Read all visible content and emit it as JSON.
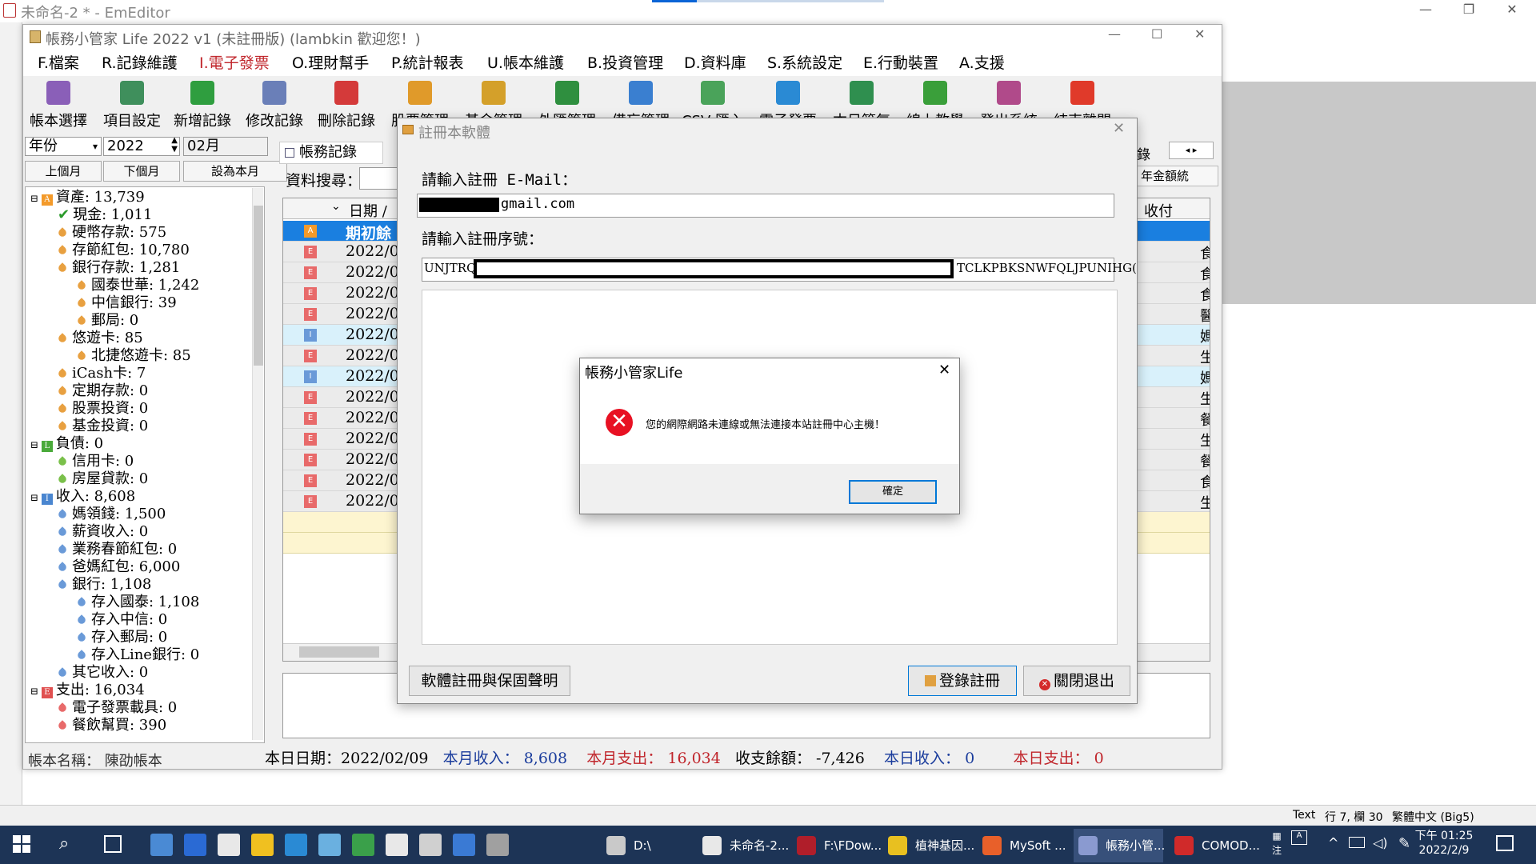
{
  "editor": {
    "title": "未命名-2 * - EmEditor",
    "status": {
      "mode": "Text",
      "position": "行 7, 欄 30",
      "encoding": "繁體中文 (Big5)"
    }
  },
  "app": {
    "title": "帳務小管家 Life 2022 v1 (未註冊版) (lambkin 歡迎您！)",
    "menu": [
      "F.檔案",
      "R.記錄維護",
      "I.電子發票",
      "O.理財幫手",
      "P.統計報表",
      "U.帳本維護",
      "B.投資管理",
      "D.資料庫",
      "S.系統設定",
      "E.行動裝置",
      "A.支援"
    ],
    "toolbar": [
      {
        "label": "帳本選擇",
        "icon": "book-select-icon",
        "color": "#8a5fb8"
      },
      {
        "label": "項目設定",
        "icon": "item-settings-icon",
        "color": "#3f8f5c"
      },
      {
        "label": "新增記錄",
        "icon": "add-record-icon",
        "color": "#2f9e3f"
      },
      {
        "label": "修改記錄",
        "icon": "edit-record-icon",
        "color": "#6a7fb8"
      },
      {
        "label": "刪除記錄",
        "icon": "delete-record-icon",
        "color": "#d43a3a"
      },
      {
        "label": "股票管理",
        "icon": "stock-icon",
        "color": "#e09a2a"
      },
      {
        "label": "基金管理",
        "icon": "fund-icon",
        "color": "#d4a02a"
      },
      {
        "label": "外匯管理",
        "icon": "forex-icon",
        "color": "#2f8f3f"
      },
      {
        "label": "備忘管理",
        "icon": "memo-icon",
        "color": "#3a7fd0"
      },
      {
        "label": "CSV 匯入",
        "icon": "csv-import-icon",
        "color": "#4aa35a"
      },
      {
        "label": "電子發票",
        "icon": "einvoice-icon",
        "color": "#2a8ad4"
      },
      {
        "label": "本日節氣",
        "icon": "solar-term-icon",
        "color": "#2f8f4f"
      },
      {
        "label": "線上教學",
        "icon": "help-icon",
        "color": "#3a9f3a"
      },
      {
        "label": "登出系統",
        "icon": "logout-icon",
        "color": "#b04a8a"
      },
      {
        "label": "結束離開",
        "icon": "exit-icon",
        "color": "#e03a2a"
      }
    ],
    "filter": {
      "period": "年份",
      "year": "2022",
      "month": "02月",
      "prev": "上個月",
      "next": "下個月",
      "set_current": "設為本月"
    },
    "tab_label": "帳務記錄",
    "search_label": "資料搜尋：",
    "right_tab": "錄",
    "right_button": "年金額統",
    "grid_header": {
      "date": "日期 /",
      "paid": "收付"
    },
    "grid_rows": [
      {
        "date": "期初餘",
        "type": "A",
        "right": ""
      },
      {
        "date": "2022/0",
        "type": "E",
        "right": "食"
      },
      {
        "date": "2022/0",
        "type": "E",
        "right": "食"
      },
      {
        "date": "2022/0",
        "type": "E",
        "right": "食"
      },
      {
        "date": "2022/0",
        "type": "E",
        "right": "醫"
      },
      {
        "date": "2022/0",
        "type": "I",
        "right": "媽"
      },
      {
        "date": "2022/0",
        "type": "E",
        "right": "生"
      },
      {
        "date": "2022/0",
        "type": "I",
        "right": "媽"
      },
      {
        "date": "2022/0",
        "type": "E",
        "right": "生"
      },
      {
        "date": "2022/0",
        "type": "E",
        "right": "餐"
      },
      {
        "date": "2022/0",
        "type": "E",
        "right": "生"
      },
      {
        "date": "2022/0",
        "type": "E",
        "right": "餐"
      },
      {
        "date": "2022/0",
        "type": "E",
        "right": "食"
      },
      {
        "date": "2022/0",
        "type": "E",
        "right": "生"
      }
    ],
    "tree": [
      {
        "text": "資產: 13,739",
        "level": 1,
        "sq": "A",
        "color": "#f39a2a"
      },
      {
        "text": "現金: 1,011",
        "level": 2,
        "check": true
      },
      {
        "text": "硬幣存款: 575",
        "level": 2,
        "color": "#e8a040"
      },
      {
        "text": "存節紅包: 10,780",
        "level": 2,
        "color": "#e8a040"
      },
      {
        "text": "銀行存款: 1,281",
        "level": 2,
        "color": "#e8a040"
      },
      {
        "text": "國泰世華: 1,242",
        "level": 3,
        "color": "#e8a040"
      },
      {
        "text": "中信銀行: 39",
        "level": 3,
        "color": "#e8a040"
      },
      {
        "text": "郵局: 0",
        "level": 3,
        "color": "#e8a040"
      },
      {
        "text": "悠遊卡: 85",
        "level": 2,
        "color": "#e8a040"
      },
      {
        "text": "北捷悠遊卡: 85",
        "level": 3,
        "color": "#e8a040"
      },
      {
        "text": "iCash卡: 7",
        "level": 2,
        "color": "#e8a040"
      },
      {
        "text": "定期存款: 0",
        "level": 2,
        "color": "#e8a040"
      },
      {
        "text": "股票投資: 0",
        "level": 2,
        "color": "#e8a040"
      },
      {
        "text": "基金投資: 0",
        "level": 2,
        "color": "#e8a040"
      },
      {
        "text": "負債: 0",
        "level": 1,
        "sq": "L",
        "color": "#4aaa3a"
      },
      {
        "text": "信用卡: 0",
        "level": 2,
        "color": "#7ac04a"
      },
      {
        "text": "房屋貸款: 0",
        "level": 2,
        "color": "#7ac04a"
      },
      {
        "text": "收入: 8,608",
        "level": 1,
        "sq": "I",
        "color": "#4a86d0"
      },
      {
        "text": "媽領錢: 1,500",
        "level": 2,
        "color": "#6a9ad8"
      },
      {
        "text": "薪資收入: 0",
        "level": 2,
        "color": "#6a9ad8"
      },
      {
        "text": "業務春節紅包: 0",
        "level": 2,
        "color": "#6a9ad8"
      },
      {
        "text": "爸媽紅包: 6,000",
        "level": 2,
        "color": "#6a9ad8"
      },
      {
        "text": "銀行: 1,108",
        "level": 2,
        "color": "#6a9ad8"
      },
      {
        "text": "存入國泰: 1,108",
        "level": 3,
        "color": "#6a9ad8"
      },
      {
        "text": "存入中信: 0",
        "level": 3,
        "color": "#6a9ad8"
      },
      {
        "text": "存入郵局: 0",
        "level": 3,
        "color": "#6a9ad8"
      },
      {
        "text": "存入Line銀行: 0",
        "level": 3,
        "color": "#6a9ad8"
      },
      {
        "text": "其它收入: 0",
        "level": 2,
        "color": "#6a9ad8"
      },
      {
        "text": "支出: 16,034",
        "level": 1,
        "sq": "E",
        "color": "#e05050"
      },
      {
        "text": "電子發票載具: 0",
        "level": 2,
        "color": "#e86a6a"
      },
      {
        "text": "餐飲幫買: 390",
        "level": 2,
        "color": "#e86a6a"
      }
    ],
    "account_name_label": "帳本名稱：",
    "account_name": "陳劭帳本",
    "summary": {
      "date_label": "本日日期：",
      "date": "2022/02/09",
      "month_income_label": "本月收入：",
      "month_income": "8,608",
      "month_expense_label": "本月支出：",
      "month_expense": "16,034",
      "balance_label": "收支餘額：",
      "balance": "-7,426",
      "day_income_label": "本日收入：",
      "day_income": "0",
      "day_expense_label": "本日支出：",
      "day_expense": "0"
    }
  },
  "register_dialog": {
    "title": "註冊本軟體",
    "email_label": "請輸入註冊 E-Mail：",
    "email_value": "gmail.com",
    "serial_label": "請輸入註冊序號：",
    "serial_prefix": "UNJTRQ",
    "serial_suffix": "TCLKPBKSNWFQLJPUNIHG(",
    "terms_button": "軟體註冊與保固聲明",
    "register_button": "登錄註冊",
    "exit_button": "關閉退出"
  },
  "message_box": {
    "title": "帳務小管家Life",
    "message": "您的網際網路未連線或無法連接本站註冊中心主機！",
    "ok": "確定"
  },
  "taskbar": {
    "apps": [
      {
        "label": "D:\\",
        "color": "#c9c9c9"
      },
      {
        "label": "未命名-2...",
        "color": "#e8e8e8"
      },
      {
        "label": "F:\\FDow...",
        "color": "#b01e2a"
      },
      {
        "label": "植神基因...",
        "color": "#e8c020"
      },
      {
        "label": "MySoft ...",
        "color": "#e8602a"
      },
      {
        "label": "帳務小管...",
        "color": "#8a9ad0"
      },
      {
        "label": "COMOD...",
        "color": "#d02a2a"
      }
    ],
    "time": "下午 01:25",
    "date": "2022/2/9"
  }
}
